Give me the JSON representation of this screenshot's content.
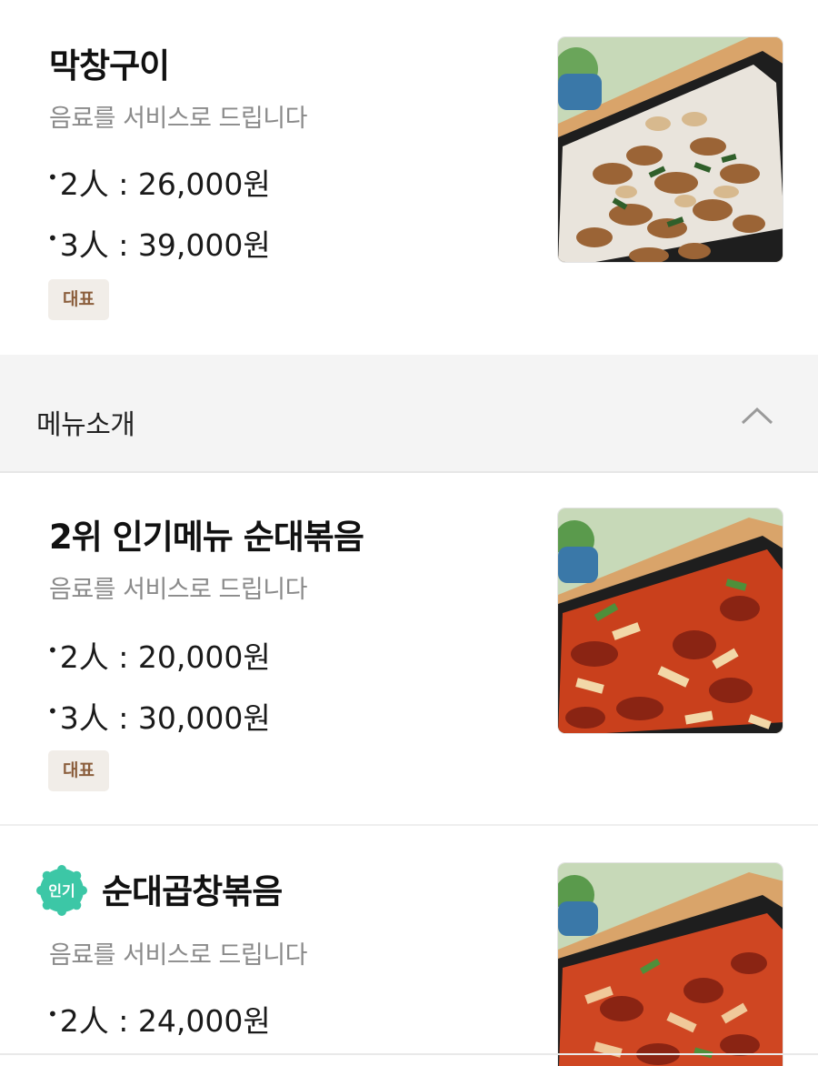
{
  "menu_items": [
    {
      "title": "막창구이",
      "description": "음료를 서비스로 드립니다",
      "prices": [
        "2人 : 26,000원",
        "3人 : 39,000원"
      ],
      "badge": "대표",
      "photo": "grilled-makchang-photo"
    },
    {
      "title": "2위 인기메뉴 순대볶음",
      "description": "음료를 서비스로 드립니다",
      "prices": [
        "2人 : 20,000원",
        "3人 : 30,000원"
      ],
      "badge": "대표",
      "photo": "spicy-sundae-stir-fry-photo"
    },
    {
      "title": "순대곱창볶음",
      "popular_badge": "인기",
      "description": "음료를 서비스로 드립니다",
      "prices": [
        "2人 : 24,000원"
      ],
      "photo": "sundae-gopchang-stir-fry-photo"
    }
  ],
  "section": {
    "title": "메뉴소개",
    "toggle_icon": "chevron-up-icon"
  },
  "colors": {
    "badge_bg": "#f1ede8",
    "badge_text": "#8b5e3c",
    "popular_badge": "#3cc7a6",
    "section_bg": "#f4f4f4",
    "description": "#8a8a8a"
  }
}
